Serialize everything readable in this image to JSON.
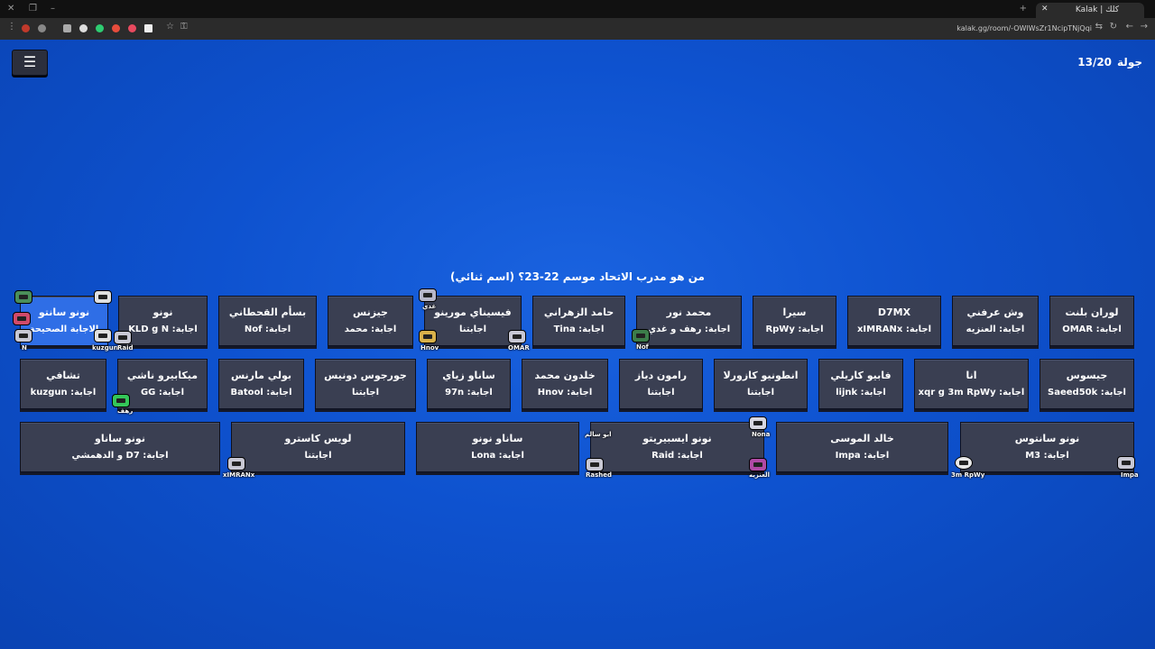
{
  "browser": {
    "tab_title": "Kalak | كلك",
    "url": "kalak.gg/room/-OWlWsZr1NcipTNjQqi"
  },
  "game": {
    "round_label": "جولة",
    "round_value": "13/20",
    "question": "من هو مدرب الاتحاد موسم 22-23؟ (اسم ثنائي)"
  },
  "row1": [
    {
      "name": "لوران بلنت",
      "answer": "اجابة: OMAR"
    },
    {
      "name": "وش عرفني",
      "answer": "اجابة: العنزيه"
    },
    {
      "name": "D7MX",
      "answer": "اجابة: xIMRANx"
    },
    {
      "name": "سيرا",
      "answer": "اجابة: RpWy"
    },
    {
      "name": "محمد نور",
      "answer": "اجابة: رهف و غدي"
    },
    {
      "name": "حامد الزهراني",
      "answer": "اجابة: Tina"
    },
    {
      "name": "فيسيناي مورينو",
      "answer": "اجابتنا"
    },
    {
      "name": "جيزنس",
      "answer": "اجابة: محمد"
    },
    {
      "name": "بسأم القحطاني",
      "answer": "اجابة: Nof"
    },
    {
      "name": "نونو",
      "answer": "اجابة: KLD g N"
    },
    {
      "name": "نونو سانتو",
      "answer": "الاجابة الصحيحة"
    }
  ],
  "row2": [
    {
      "name": "جيسوس",
      "answer": "اجابة: Saeed50k"
    },
    {
      "name": "انا",
      "answer": "اجابة: xqr g 3m RpWy"
    },
    {
      "name": "فابيو كاريلي",
      "answer": "اجابة: lijnk"
    },
    {
      "name": "انطونيو كازورلا",
      "answer": "اجابتنا"
    },
    {
      "name": "رامون دياز",
      "answer": "اجابتنا"
    },
    {
      "name": "خلدون محمد",
      "answer": "اجابة: Hnov"
    },
    {
      "name": "ساناو زياي",
      "answer": "اجابة: 97n"
    },
    {
      "name": "جورجوس دونيس",
      "answer": "اجابتنا"
    },
    {
      "name": "بولي مارنس",
      "answer": "اجابة: Batool"
    },
    {
      "name": "ميكابيرو ناشي",
      "answer": "اجابة: GG"
    },
    {
      "name": "تشافي",
      "answer": "اجابة: kuzgun"
    }
  ],
  "row3": [
    {
      "name": "نونو سانتوس",
      "answer": "اجابة: M3"
    },
    {
      "name": "خالد الموسى",
      "answer": "اجابة: Impa"
    },
    {
      "name": "نونو ايسبيريتو",
      "answer": "اجابة: Raid"
    },
    {
      "name": "ساناو نونو",
      "answer": "اجابة: Lona"
    },
    {
      "name": "لويس كاسترو",
      "answer": "اجابتنا"
    },
    {
      "name": "نونو ساناو",
      "answer": "اجابة: D7 و الدهمشي"
    }
  ],
  "players": [
    {
      "name": "غدي",
      "color": "#b7b7c9"
    },
    {
      "name": "Hnov",
      "color": "#d9b14a"
    },
    {
      "name": "OMAR",
      "color": "#c8c8d4"
    },
    {
      "name": "Nof",
      "color": "#3c7d4a"
    },
    {
      "name": "Nona",
      "color": "#d7d7e0"
    },
    {
      "name": "ابو سالم",
      "color": "#c8c8d4"
    },
    {
      "name": "Rashed",
      "color": "#c8c8d4"
    },
    {
      "name": "العنزيه",
      "color": "#b04aa5"
    },
    {
      "name": "3m RpWy",
      "color": "#e8e8e8"
    },
    {
      "name": "Impa",
      "color": "#c8c8d4"
    },
    {
      "name": "xIMRANx",
      "color": "#c8c8d4"
    },
    {
      "name": "رهف",
      "color": "#34c759"
    },
    {
      "name": "kuzgun",
      "color": "#e0e0e0"
    },
    {
      "name": "Raid",
      "color": "#c8c8d4"
    },
    {
      "name": "N",
      "color": "#d04a6a"
    }
  ]
}
